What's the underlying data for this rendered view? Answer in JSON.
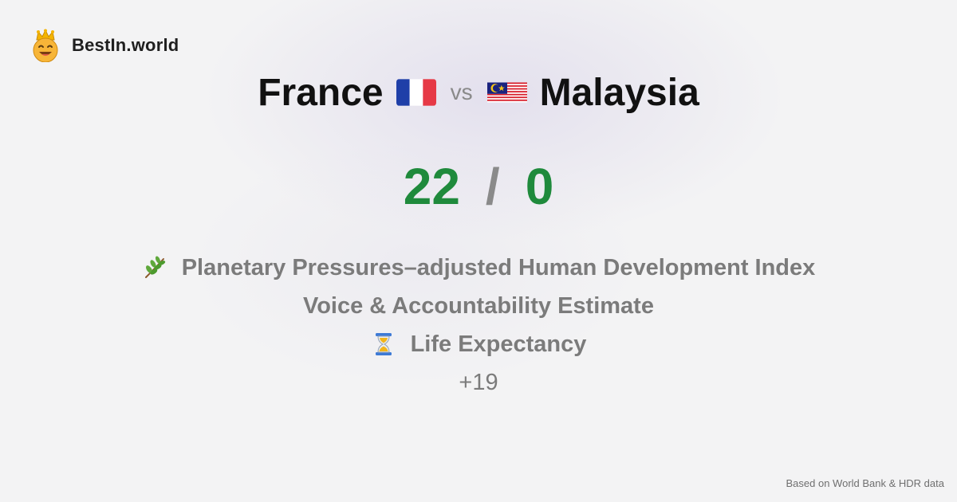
{
  "brand": {
    "name": "BestIn.world",
    "logo_icon": "crowned-smiley-icon"
  },
  "comparison": {
    "left_country": "France",
    "right_country": "Malaysia",
    "vs_label": "vs",
    "left_flag": "flag-france-icon",
    "right_flag": "flag-malaysia-icon"
  },
  "score": {
    "left": "22",
    "separator": "/",
    "right": "0",
    "color": "#1f8a3c"
  },
  "metrics": [
    {
      "label": "Planetary Pressures–adjusted Human Development Index",
      "icon": "herb-icon"
    },
    {
      "label": "Voice & Accountability Estimate",
      "icon": ""
    },
    {
      "label": "Life Expectancy",
      "icon": "hourglass-icon"
    }
  ],
  "more_label": "+19",
  "footer": {
    "source": "Based on World Bank & HDR data"
  }
}
